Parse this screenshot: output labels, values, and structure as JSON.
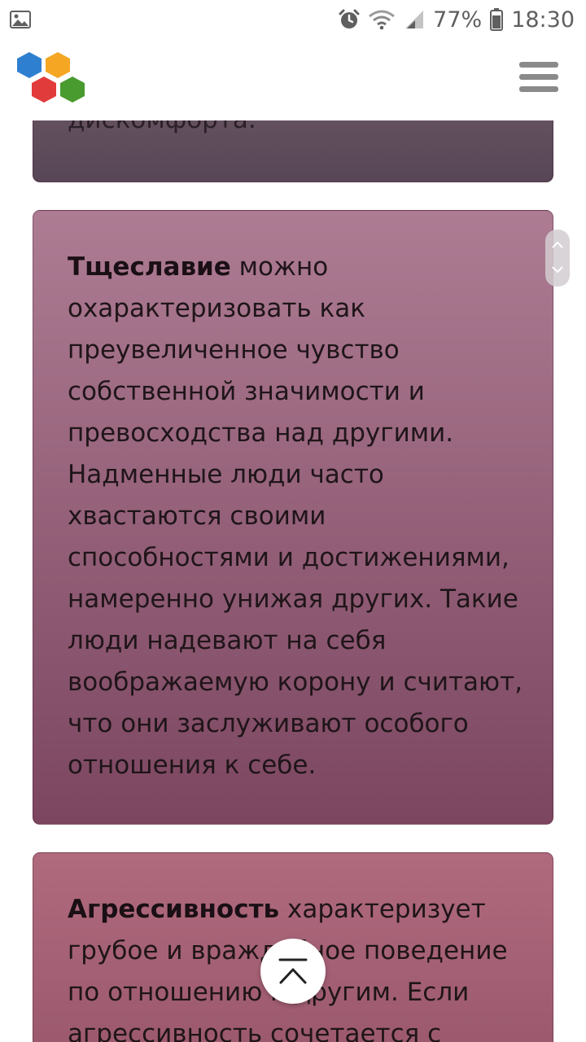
{
  "status_bar": {
    "battery_percent": "77%",
    "time": "18:30",
    "icons": [
      "gallery-icon",
      "alarm-icon",
      "wifi-icon",
      "signal-icon",
      "battery-icon"
    ]
  },
  "header": {
    "logo": "hexagon-logo",
    "menu_icon": "hamburger-menu-icon",
    "logo_colors": [
      "#2f7fd0",
      "#f5a623",
      "#e23b3b",
      "#4a9b2f"
    ]
  },
  "cards": {
    "top_fragment": "дискомфорта.",
    "vanity": {
      "term": "Тщеславие",
      "text": "можно охарактеризовать как преувеличенное чувство собственной значимости и превосходства над другими. Надменные люди часто хвастаются своими способностями и достижениями, намеренно унижая других. Такие люди надевают на себя воображаемую корону и считают, что они заслуживают особого отношения к себе."
    },
    "aggression": {
      "term": "Агрессивность",
      "text": "характеризует грубое и враждебное поведение по отношению к другим. Если агрессивность сочетается с"
    }
  },
  "colors": {
    "card_top": "#5f4c5c",
    "card_main": "#95617a",
    "card_bottom": "#a76377"
  }
}
